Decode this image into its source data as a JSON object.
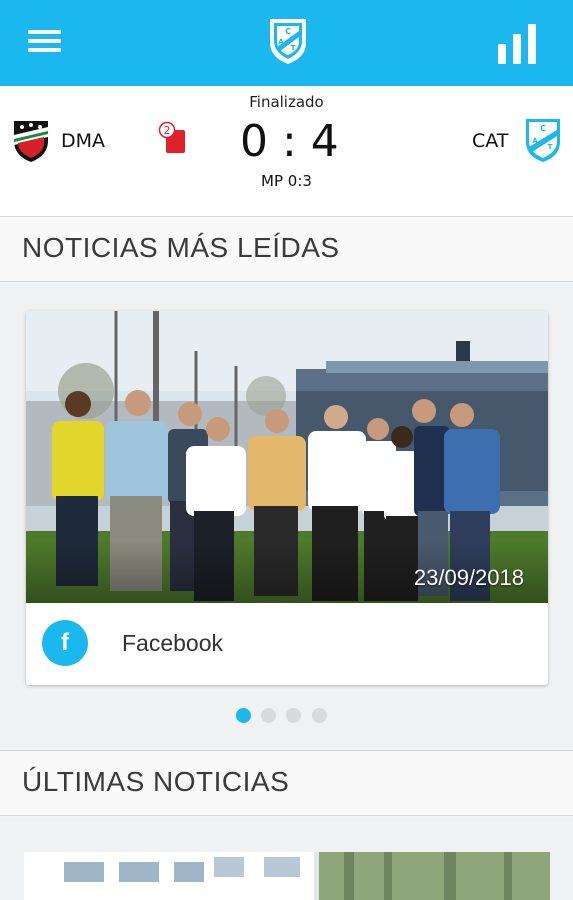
{
  "appbar": {
    "menu_icon": "hamburger-menu-icon",
    "logo_icon": "club-crest-icon",
    "stats_icon": "bar-chart-icon"
  },
  "match": {
    "status": "Finalizado",
    "home_team": "DMA",
    "away_team": "CAT",
    "red_cards_home": "2",
    "score": "0 : 4",
    "aggregate": "MP 0:3"
  },
  "sections": {
    "most_read": "NOTICIAS MÁS LEÍDAS",
    "latest": "ÚLTIMAS NOTICIAS"
  },
  "featured": {
    "date": "23/09/2018",
    "source_icon": "facebook-icon",
    "source_letter": "f",
    "source_name": "Facebook"
  },
  "carousel": {
    "page_count": 4,
    "active_index": 0
  },
  "colors": {
    "accent": "#1ab8ee",
    "red_card": "#e0202a"
  }
}
